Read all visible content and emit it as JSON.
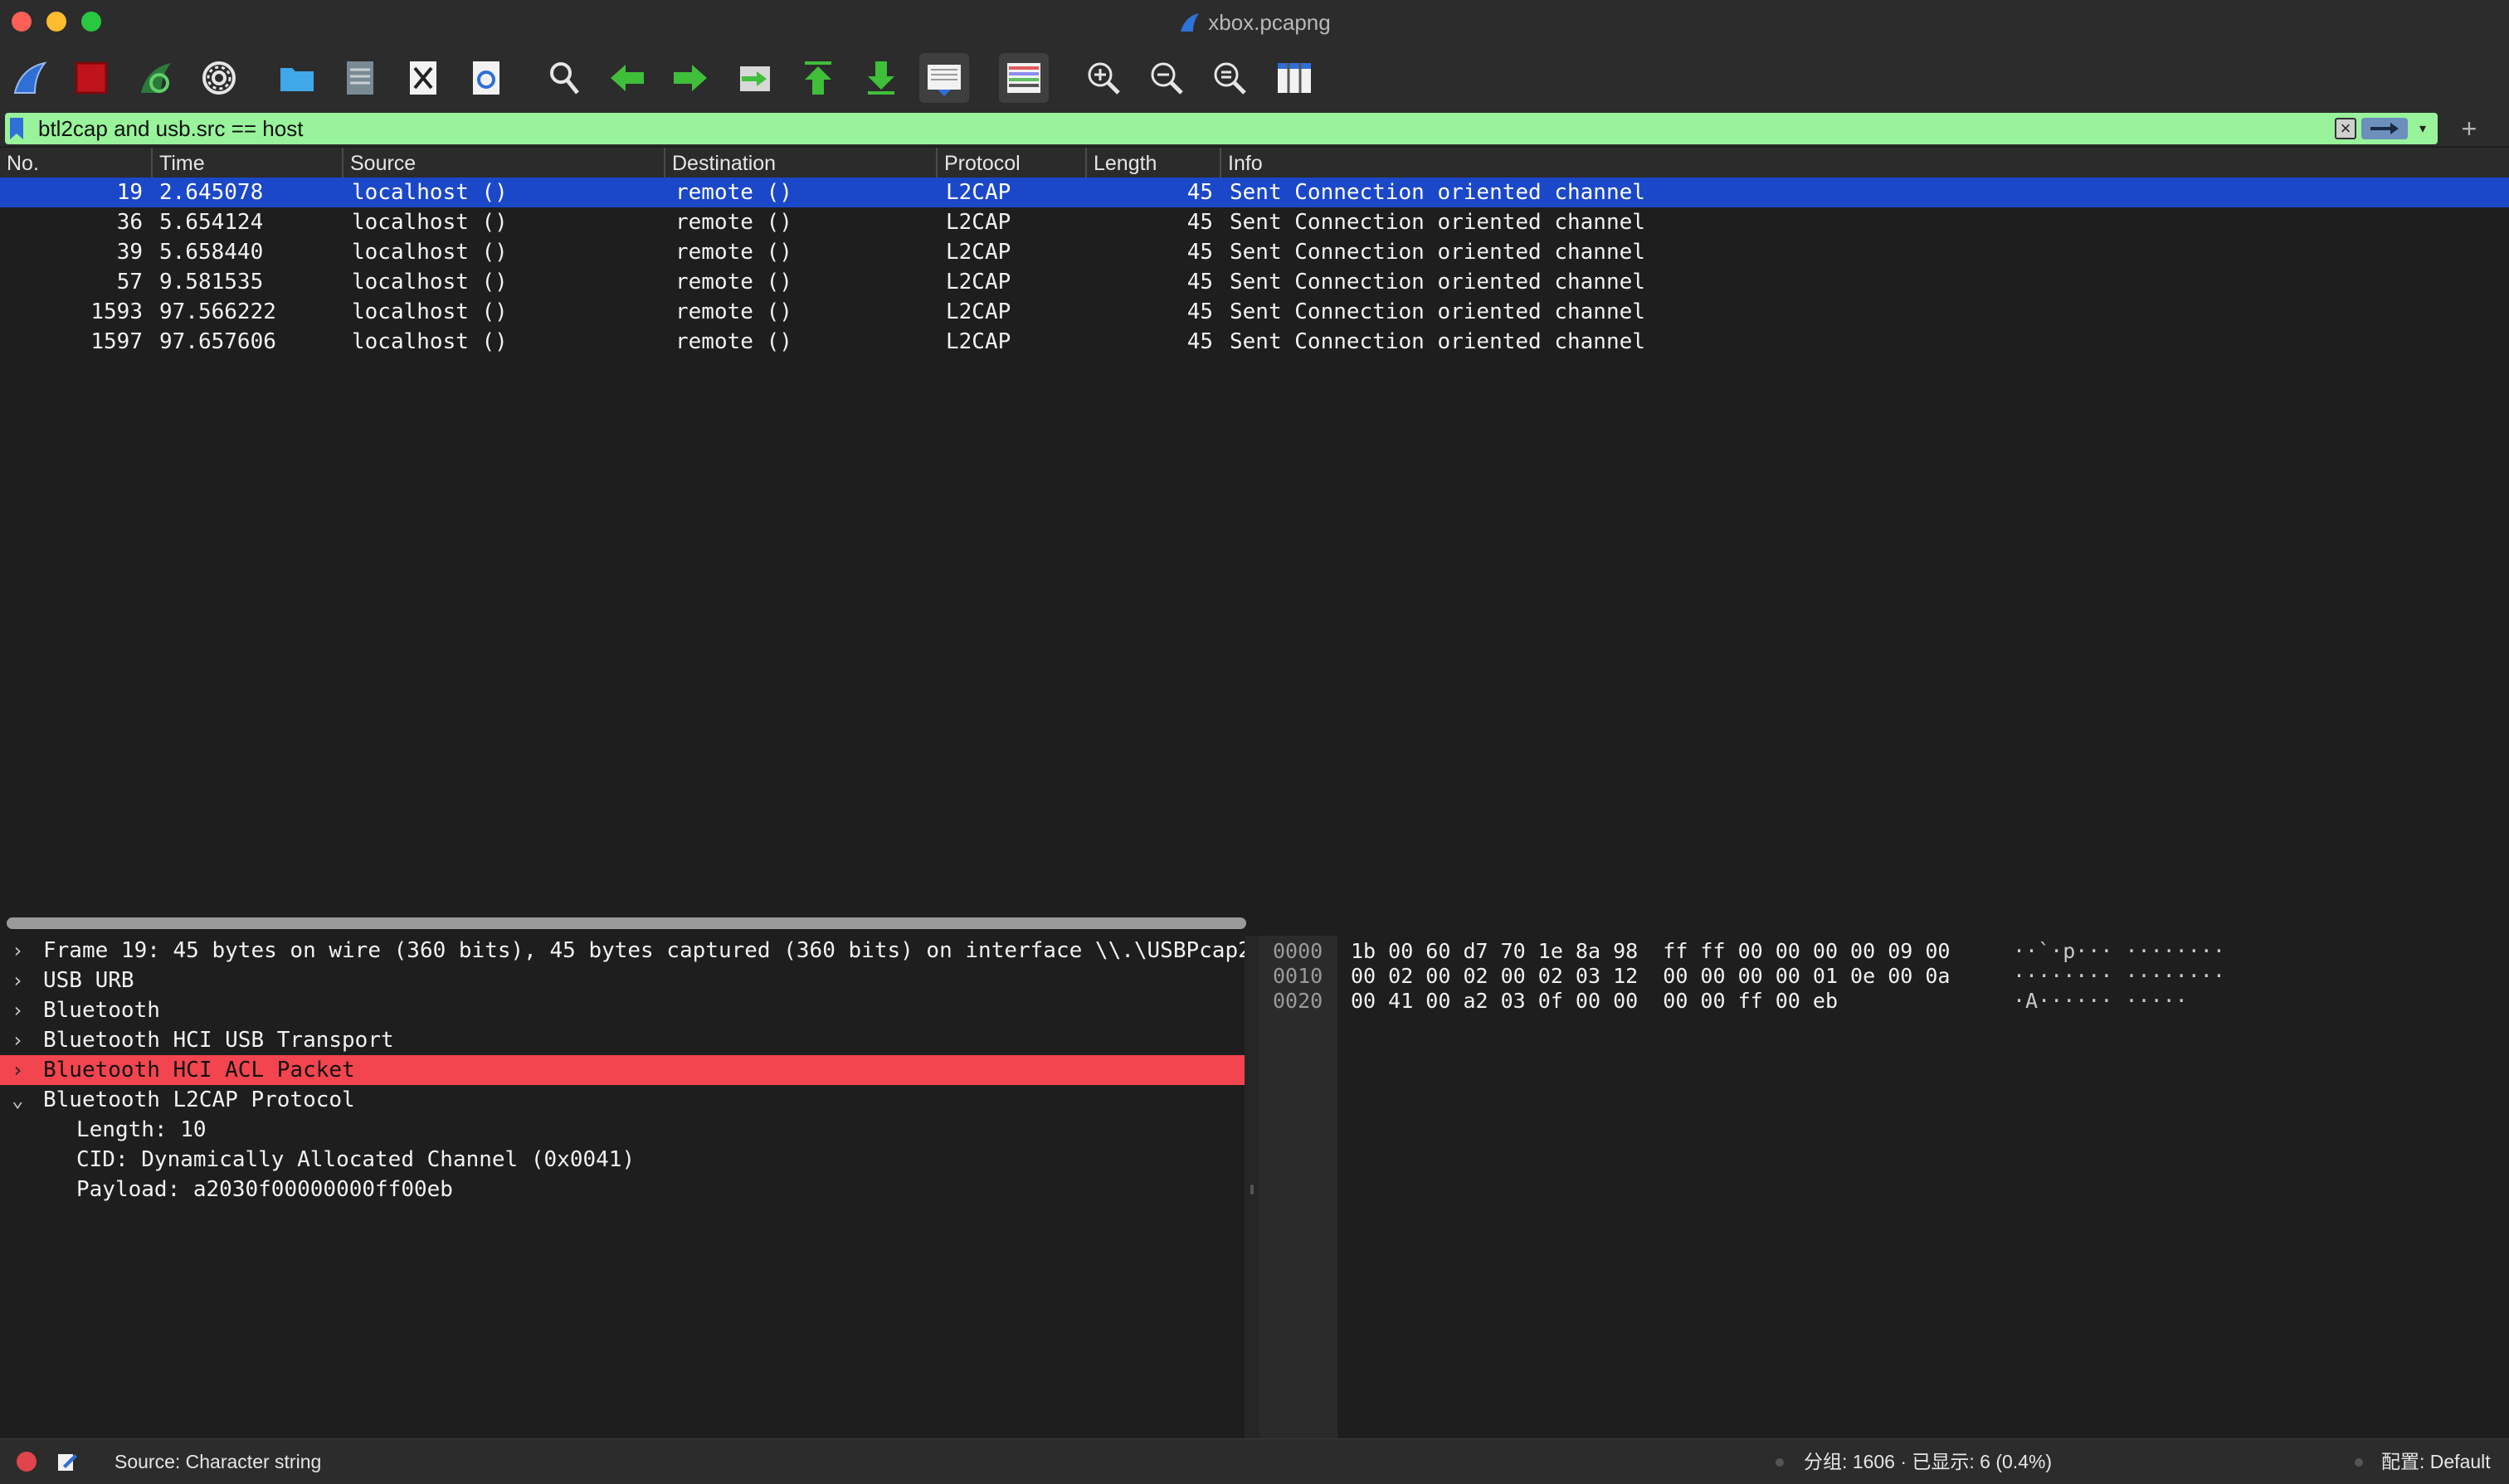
{
  "window": {
    "title": "xbox.pcapng",
    "traffic_lights": {
      "close": "#fe5f57",
      "minimize": "#febc2e",
      "zoom": "#28c840"
    }
  },
  "toolbar": {
    "buttons": [
      {
        "name": "start-capture-button",
        "icon": "shark-fin-icon"
      },
      {
        "name": "stop-capture-button",
        "icon": "stop-square-icon"
      },
      {
        "name": "restart-capture-button",
        "icon": "restart-fin-icon"
      },
      {
        "name": "capture-options-button",
        "icon": "gear-icon"
      },
      {
        "name": "open-file-button",
        "icon": "folder-icon"
      },
      {
        "name": "save-file-button",
        "icon": "file-icon"
      },
      {
        "name": "close-file-button",
        "icon": "close-file-icon"
      },
      {
        "name": "reload-file-button",
        "icon": "reload-icon"
      },
      {
        "name": "find-packet-button",
        "icon": "magnifier-icon"
      },
      {
        "name": "go-back-button",
        "icon": "arrow-left-icon"
      },
      {
        "name": "go-forward-button",
        "icon": "arrow-right-icon"
      },
      {
        "name": "go-to-packet-button",
        "icon": "jump-to-icon"
      },
      {
        "name": "go-first-packet-button",
        "icon": "arrow-up-bar-icon"
      },
      {
        "name": "go-last-packet-button",
        "icon": "arrow-down-bar-icon"
      },
      {
        "name": "auto-scroll-button",
        "icon": "autoscroll-icon"
      },
      {
        "name": "colorize-button",
        "icon": "colorize-icon"
      },
      {
        "name": "zoom-in-button",
        "icon": "zoom-in-icon"
      },
      {
        "name": "zoom-out-button",
        "icon": "zoom-out-icon"
      },
      {
        "name": "normal-size-button",
        "icon": "zoom-reset-icon"
      },
      {
        "name": "resize-columns-button",
        "icon": "resize-columns-icon"
      }
    ]
  },
  "filter": {
    "value": "btl2cap and usb.src == host",
    "background": "#98f39a",
    "add_label": "+"
  },
  "packet_list": {
    "columns": [
      "No.",
      "Time",
      "Source",
      "Destination",
      "Protocol",
      "Length",
      "Info"
    ],
    "rows": [
      {
        "no": "19",
        "time": "2.645078",
        "source": "localhost ()",
        "destination": "remote ()",
        "protocol": "L2CAP",
        "length": "45",
        "info": "Sent Connection oriented channel",
        "selected": true
      },
      {
        "no": "36",
        "time": "5.654124",
        "source": "localhost ()",
        "destination": "remote ()",
        "protocol": "L2CAP",
        "length": "45",
        "info": "Sent Connection oriented channel",
        "selected": false
      },
      {
        "no": "39",
        "time": "5.658440",
        "source": "localhost ()",
        "destination": "remote ()",
        "protocol": "L2CAP",
        "length": "45",
        "info": "Sent Connection oriented channel",
        "selected": false
      },
      {
        "no": "57",
        "time": "9.581535",
        "source": "localhost ()",
        "destination": "remote ()",
        "protocol": "L2CAP",
        "length": "45",
        "info": "Sent Connection oriented channel",
        "selected": false
      },
      {
        "no": "1593",
        "time": "97.566222",
        "source": "localhost ()",
        "destination": "remote ()",
        "protocol": "L2CAP",
        "length": "45",
        "info": "Sent Connection oriented channel",
        "selected": false
      },
      {
        "no": "1597",
        "time": "97.657606",
        "source": "localhost ()",
        "destination": "remote ()",
        "protocol": "L2CAP",
        "length": "45",
        "info": "Sent Connection oriented channel",
        "selected": false
      }
    ],
    "selection_color": "#1b48c8"
  },
  "details": {
    "items": [
      {
        "text": "Frame 19: 45 bytes on wire (360 bits), 45 bytes captured (360 bits) on interface \\\\.\\USBPcap2",
        "chevron": "›",
        "highlighted": false,
        "child": false
      },
      {
        "text": "USB URB",
        "chevron": "›",
        "highlighted": false,
        "child": false
      },
      {
        "text": "Bluetooth",
        "chevron": "›",
        "highlighted": false,
        "child": false
      },
      {
        "text": "Bluetooth HCI USB Transport",
        "chevron": "›",
        "highlighted": false,
        "child": false
      },
      {
        "text": "Bluetooth HCI ACL Packet",
        "chevron": "›",
        "highlighted": true,
        "child": false
      },
      {
        "text": "Bluetooth L2CAP Protocol",
        "chevron": "⌄",
        "highlighted": false,
        "child": false
      },
      {
        "text": "Length: 10",
        "chevron": "",
        "highlighted": false,
        "child": true
      },
      {
        "text": "CID: Dynamically Allocated Channel (0x0041)",
        "chevron": "",
        "highlighted": false,
        "child": true
      },
      {
        "text": "Payload: a2030f00000000ff00eb",
        "chevron": "",
        "highlighted": false,
        "child": true
      }
    ],
    "highlight_color": "#f2454f"
  },
  "bytes": {
    "rows": [
      {
        "offset": "0000",
        "hex": "1b 00 60 d7 70 1e 8a 98  ff ff 00 00 00 00 09 00",
        "ascii": "··`·p··· ········"
      },
      {
        "offset": "0010",
        "hex": "00 02 00 02 00 02 03 12  00 00 00 00 01 0e 00 0a",
        "ascii": "········ ········"
      },
      {
        "offset": "0020",
        "hex": "00 41 00 a2 03 0f 00 00  00 00 ff 00 eb",
        "ascii": "·A······ ·····"
      }
    ]
  },
  "status": {
    "text": "Source: Character string",
    "packets": "分组: 1606 · 已显示: 6 (0.4%)",
    "profile": "配置: Default"
  }
}
